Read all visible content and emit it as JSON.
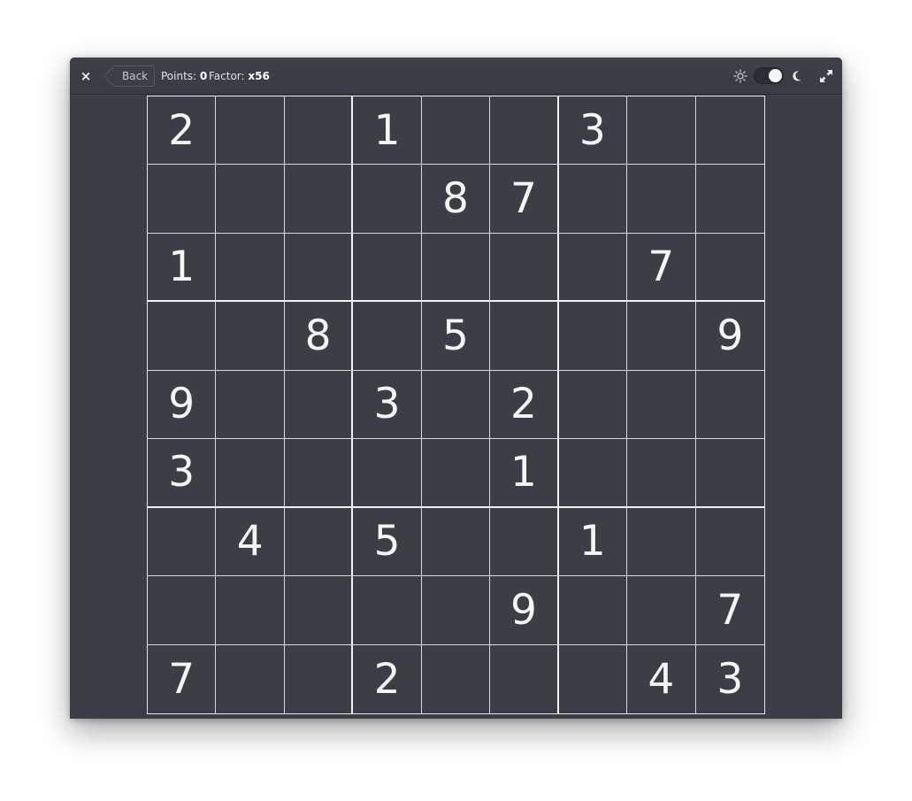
{
  "header": {
    "close_label": "×",
    "back_label": "Back",
    "points_label": "Points:",
    "points_value": "0",
    "factor_label": "Factor:",
    "factor_value": "x56",
    "icons": [
      "close-icon",
      "sun-icon",
      "theme-toggle",
      "moon-icon",
      "fullscreen-icon"
    ]
  },
  "theme": {
    "mode": "dark",
    "background": "#3b3e45",
    "text_color": "#f5f5f5",
    "grid_line_color": "#d8d8d8"
  },
  "board": {
    "rows": [
      [
        "2",
        "",
        "",
        "1",
        "",
        "",
        "3",
        "",
        ""
      ],
      [
        "",
        "",
        "",
        "",
        "8",
        "7",
        "",
        "",
        ""
      ],
      [
        "1",
        "",
        "",
        "",
        "",
        "",
        "",
        "7",
        ""
      ],
      [
        "",
        "",
        "8",
        "",
        "5",
        "",
        "",
        "",
        "9"
      ],
      [
        "9",
        "",
        "",
        "3",
        "",
        "2",
        "",
        "",
        ""
      ],
      [
        "3",
        "",
        "",
        "",
        "",
        "1",
        "",
        "",
        ""
      ],
      [
        "",
        "4",
        "",
        "5",
        "",
        "",
        "1",
        "",
        ""
      ],
      [
        "",
        "",
        "",
        "",
        "",
        "9",
        "",
        "",
        "7"
      ],
      [
        "7",
        "",
        "",
        "2",
        "",
        "",
        "",
        "4",
        "3"
      ]
    ]
  }
}
